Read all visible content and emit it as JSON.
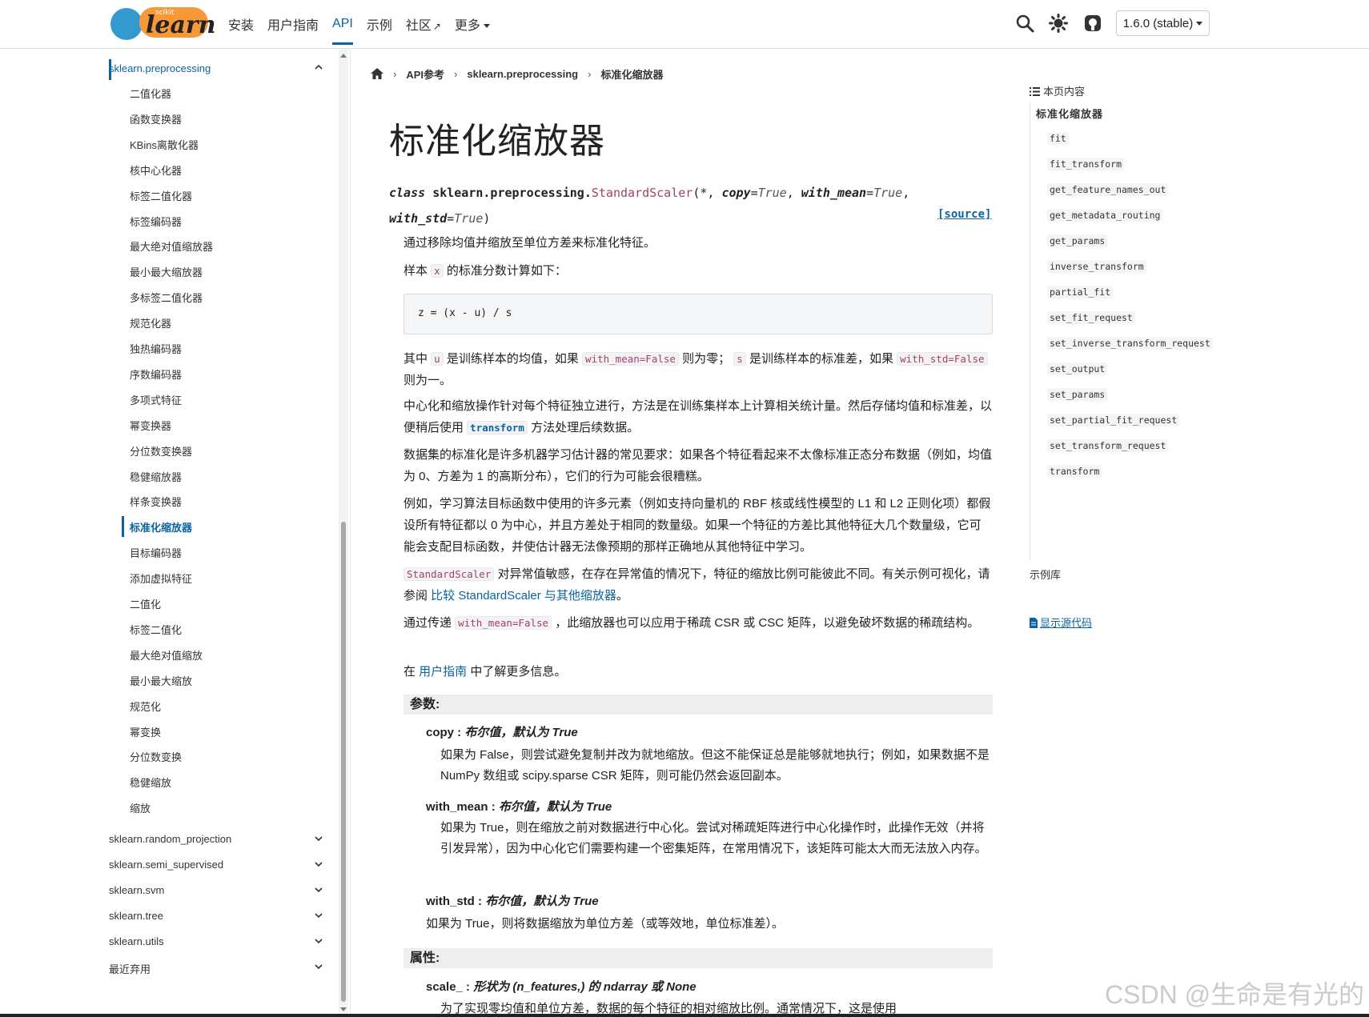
{
  "nav": {
    "logo_small": "scikit",
    "logo_big": "learn",
    "links": [
      {
        "label": "安装"
      },
      {
        "label": "用户指南"
      },
      {
        "label": "API"
      },
      {
        "label": "示例"
      },
      {
        "label": "社区"
      },
      {
        "label": "更多"
      }
    ],
    "version": "1.6.0 (stable)"
  },
  "sidebar": {
    "open_module": "sklearn.preprocessing",
    "items": [
      "二值化器",
      "函数变换器",
      "KBins离散化器",
      "核中心化器",
      "标签二值化器",
      "标签编码器",
      "最大绝对值缩放器",
      "最小最大缩放器",
      "多标签二值化器",
      "规范化器",
      "独热编码器",
      "序数编码器",
      "多项式特征",
      "幂变换器",
      "分位数变换器",
      "稳健缩放器",
      "样条变换器",
      "标准化缩放器",
      "目标编码器",
      "添加虚拟特征",
      "二值化",
      "标签二值化",
      "最大绝对值缩放",
      "最小最大缩放",
      "规范化",
      "幂变换",
      "分位数变换",
      "稳健缩放",
      "缩放"
    ],
    "current_item": "标准化缩放器",
    "modules": [
      "sklearn.random_projection",
      "sklearn.semi_supervised",
      "sklearn.svm",
      "sklearn.tree",
      "sklearn.utils",
      "最近弃用"
    ]
  },
  "breadcrumb": [
    "API参考",
    "sklearn.preprocessing",
    "标准化缩放器"
  ],
  "main": {
    "title": "标准化缩放器",
    "signature": {
      "keyword": "class",
      "module": "sklearn.preprocessing.",
      "name": "StandardScaler",
      "open": "(",
      "star": "*, ",
      "params": [
        {
          "name": "copy",
          "default": "True"
        },
        {
          "name": "with_mean",
          "default": "True"
        },
        {
          "name": "with_std",
          "default": "True"
        }
      ],
      "close": ")",
      "source": "[source]"
    },
    "p1": "通过移除均值并缩放至单位方差来标准化特征。",
    "p2": {
      "a": "样本 ",
      "code": "x",
      "b": " 的标准分数计算如下："
    },
    "formula": "z = (x - u) / s",
    "p3": {
      "a": "其中 ",
      "c1": "u",
      "b": " 是训练样本的均值，如果 ",
      "c2": "with_mean=False",
      "c": " 则为零； ",
      "c3": "s",
      "d": " 是训练样本的标准差，如果 ",
      "c4": "with_std=False",
      "e": " 则为一。"
    },
    "p4": {
      "a": "中心化和缩放操作针对每个特征独立进行，方法是在训练集样本上计算相关统计量。然后存储均值和标准差，以便稍后使用 ",
      "code": "transform",
      "b": " 方法处理后续数据。"
    },
    "p5": "数据集的标准化是许多机器学习估计器的常见要求：如果各个特征看起来不太像标准正态分布数据（例如，均值为 0、方差为 1 的高斯分布），它们的行为可能会很糟糕。",
    "p6": "例如，学习算法目标函数中使用的许多元素（例如支持向量机的 RBF 核或线性模型的 L1 和 L2 正则化项）都假设所有特征都以 0 为中心，并且方差处于相同的数量级。如果一个特征的方差比其他特征大几个数量级，它可能会支配目标函数，并使估计器无法像预期的那样正确地从其他特征中学习。",
    "p7": {
      "code": "StandardScaler",
      "a": " 对异常值敏感，在存在异常值的情况下，特征的缩放比例可能彼此不同。有关示例可视化，请参阅 ",
      "link": "比较 StandardScaler 与其他缩放器",
      "b": "。"
    },
    "p8": {
      "a": "通过传递 ",
      "code": "with_mean=False",
      "b": " ，此缩放器也可以应用于稀疏 CSR 或 CSC 矩阵，以避免破坏数据的稀疏结构。"
    },
    "p9": {
      "a": "在 ",
      "link": "用户指南",
      "b": " 中了解更多信息。"
    },
    "params_label": "参数:",
    "params": [
      {
        "name": "copy",
        "sep": " : ",
        "type": "布尔值，默认为 True",
        "desc": "如果为 False，则尝试避免复制并改为就地缩放。但这不能保证总是能够就地执行；例如，如果数据不是 NumPy 数组或 scipy.sparse CSR 矩阵，则可能仍然会返回副本。"
      },
      {
        "name": "with_mean",
        "sep": " : ",
        "type": "布尔值，默认为 True",
        "desc": "如果为 True，则在缩放之前对数据进行中心化。尝试对稀疏矩阵进行中心化操作时，此操作无效（并将引发异常），因为中心化它们需要构建一个密集矩阵，在常用情况下，该矩阵可能太大而无法放入内存。"
      },
      {
        "name": "with_std",
        "sep": " : ",
        "type": "布尔值，默认为 True",
        "desc": "如果为 True，则将数据缩放为单位方差（或等效地，单位标准差）。"
      }
    ],
    "attrs_label": "属性:",
    "attr": {
      "name": "scale_",
      "sep": " : ",
      "type": "形状为 (n_features,) 的 ndarray 或 None",
      "desc": "为了实现零均值和单位方差，数据的每个特征的相对缩放比例。通常情况下，这是使用"
    }
  },
  "toc": {
    "head": "本页内容",
    "h1": "标准化缩放器",
    "items": [
      "fit",
      "fit_transform",
      "get_feature_names_out",
      "get_metadata_routing",
      "get_params",
      "inverse_transform",
      "partial_fit",
      "set_fit_request",
      "set_inverse_transform_request",
      "set_output",
      "set_params",
      "set_partial_fit_request",
      "set_transform_request",
      "transform"
    ],
    "gallery": "示例库",
    "show_source": "显示源代码"
  },
  "watermark": "CSDN @生命是有光的",
  "colors": {
    "accent": "#0a63a0",
    "code": "#a3416d",
    "logo_blue": "#3499cd",
    "logo_orange": "#f89939"
  }
}
